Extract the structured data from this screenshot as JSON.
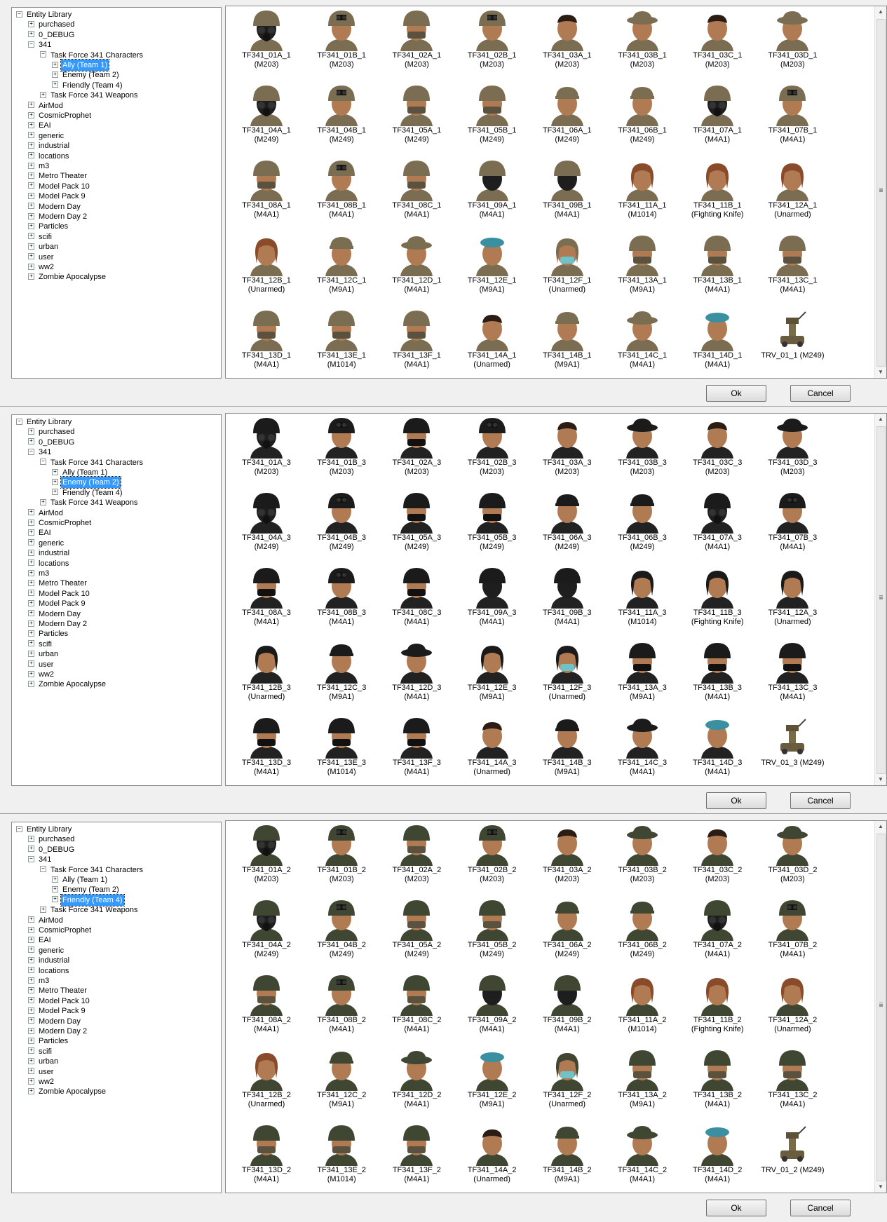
{
  "panels": [
    {
      "selected": "ally",
      "tree": [
        "Entity Library",
        "purchased",
        "0_DEBUG",
        "341",
        "Task Force 341 Characters",
        "Ally (Team 1)",
        "Enemy (Team 2)",
        "Friendly (Team 4)",
        "Task Force 341 Weapons",
        "AirMod",
        "CosmicProphet",
        "EAI",
        "generic",
        "industrial",
        "locations",
        "m3",
        "Metro Theater",
        "Model Pack 10",
        "Model Pack 9",
        "Modern Day",
        "Modern Day 2",
        "Particles",
        "scifi",
        "urban",
        "user",
        "ww2",
        "Zombie Apocalypse"
      ],
      "items": [
        [
          "TF341_01A_1",
          "(M203)",
          "gasmask"
        ],
        [
          "TF341_01B_1",
          "(M203)",
          "nvg"
        ],
        [
          "TF341_02A_1",
          "(M203)",
          "helmet"
        ],
        [
          "TF341_02B_1",
          "(M203)",
          "nvg"
        ],
        [
          "TF341_03A_1",
          "(M203)",
          "face"
        ],
        [
          "TF341_03B_1",
          "(M203)",
          "boonie"
        ],
        [
          "TF341_03C_1",
          "(M203)",
          "face"
        ],
        [
          "TF341_03D_1",
          "(M203)",
          "boonie"
        ],
        [
          "TF341_04A_1",
          "(M249)",
          "gasmask"
        ],
        [
          "TF341_04B_1",
          "(M249)",
          "nvg"
        ],
        [
          "TF341_05A_1",
          "(M249)",
          "helmet"
        ],
        [
          "TF341_05B_1",
          "(M249)",
          "helmet"
        ],
        [
          "TF341_06A_1",
          "(M249)",
          "cap"
        ],
        [
          "TF341_06B_1",
          "(M249)",
          "cap"
        ],
        [
          "TF341_07A_1",
          "(M4A1)",
          "gasmask"
        ],
        [
          "TF341_07B_1",
          "(M4A1)",
          "nvg"
        ],
        [
          "TF341_08A_1",
          "(M4A1)",
          "helmet"
        ],
        [
          "TF341_08B_1",
          "(M4A1)",
          "nvg"
        ],
        [
          "TF341_08C_1",
          "(M4A1)",
          "helmet"
        ],
        [
          "TF341_09A_1",
          "(M4A1)",
          "balaclava"
        ],
        [
          "TF341_09B_1",
          "(M4A1)",
          "balaclava"
        ],
        [
          "TF341_11A_1",
          "(M1014)",
          "woman"
        ],
        [
          "TF341_11B_1",
          "(Fighting Knife)",
          "woman"
        ],
        [
          "TF341_12A_1",
          "(Unarmed)",
          "woman"
        ],
        [
          "TF341_12B_1",
          "(Unarmed)",
          "woman"
        ],
        [
          "TF341_12C_1",
          "(M9A1)",
          "cap"
        ],
        [
          "TF341_12D_1",
          "(M4A1)",
          "boonie"
        ],
        [
          "TF341_12E_1",
          "(M9A1)",
          "beret"
        ],
        [
          "TF341_12F_1",
          "(Unarmed)",
          "mask"
        ],
        [
          "TF341_13A_1",
          "(M9A1)",
          "helmet"
        ],
        [
          "TF341_13B_1",
          "(M4A1)",
          "helmet"
        ],
        [
          "TF341_13C_1",
          "(M4A1)",
          "helmet"
        ],
        [
          "TF341_13D_1",
          "(M4A1)",
          "helmet"
        ],
        [
          "TF341_13E_1",
          "(M1014)",
          "helmet"
        ],
        [
          "TF341_13F_1",
          "(M4A1)",
          "helmet"
        ],
        [
          "TF341_14A_1",
          "(Unarmed)",
          "face"
        ],
        [
          "TF341_14B_1",
          "(M9A1)",
          "cap"
        ],
        [
          "TF341_14C_1",
          "(M4A1)",
          "boonie"
        ],
        [
          "TF341_14D_1",
          "(M4A1)",
          "beret"
        ],
        [
          "TRV_01_1 (M249)",
          "",
          "robot"
        ]
      ],
      "tone": "camo"
    },
    {
      "selected": "enemy",
      "tree": [
        "Entity Library",
        "purchased",
        "0_DEBUG",
        "341",
        "Task Force 341 Characters",
        "Ally (Team 1)",
        "Enemy (Team 2)",
        "Friendly (Team 4)",
        "Task Force 341 Weapons",
        "AirMod",
        "CosmicProphet",
        "EAI",
        "generic",
        "industrial",
        "locations",
        "m3",
        "Metro Theater",
        "Model Pack 10",
        "Model Pack 9",
        "Modern Day",
        "Modern Day 2",
        "Particles",
        "scifi",
        "urban",
        "user",
        "ww2",
        "Zombie Apocalypse"
      ],
      "items": [
        [
          "TF341_01A_3",
          "(M203)",
          "gasmask"
        ],
        [
          "TF341_01B_3",
          "(M203)",
          "nvg"
        ],
        [
          "TF341_02A_3",
          "(M203)",
          "helmet"
        ],
        [
          "TF341_02B_3",
          "(M203)",
          "nvg"
        ],
        [
          "TF341_03A_3",
          "(M203)",
          "face"
        ],
        [
          "TF341_03B_3",
          "(M203)",
          "boonie"
        ],
        [
          "TF341_03C_3",
          "(M203)",
          "face"
        ],
        [
          "TF341_03D_3",
          "(M203)",
          "boonie"
        ],
        [
          "TF341_04A_3",
          "(M249)",
          "gasmask"
        ],
        [
          "TF341_04B_3",
          "(M249)",
          "nvg"
        ],
        [
          "TF341_05A_3",
          "(M249)",
          "helmet"
        ],
        [
          "TF341_05B_3",
          "(M249)",
          "helmet"
        ],
        [
          "TF341_06A_3",
          "(M249)",
          "cap"
        ],
        [
          "TF341_06B_3",
          "(M249)",
          "cap"
        ],
        [
          "TF341_07A_3",
          "(M4A1)",
          "gasmask"
        ],
        [
          "TF341_07B_3",
          "(M4A1)",
          "nvg"
        ],
        [
          "TF341_08A_3",
          "(M4A1)",
          "helmet"
        ],
        [
          "TF341_08B_3",
          "(M4A1)",
          "nvg"
        ],
        [
          "TF341_08C_3",
          "(M4A1)",
          "helmet"
        ],
        [
          "TF341_09A_3",
          "(M4A1)",
          "balaclava"
        ],
        [
          "TF341_09B_3",
          "(M4A1)",
          "balaclava"
        ],
        [
          "TF341_11A_3",
          "(M1014)",
          "woman"
        ],
        [
          "TF341_11B_3",
          "(Fighting Knife)",
          "woman"
        ],
        [
          "TF341_12A_3",
          "(Unarmed)",
          "woman"
        ],
        [
          "TF341_12B_3",
          "(Unarmed)",
          "woman"
        ],
        [
          "TF341_12C_3",
          "(M9A1)",
          "cap"
        ],
        [
          "TF341_12D_3",
          "(M4A1)",
          "boonie"
        ],
        [
          "TF341_12E_3",
          "(M9A1)",
          "woman"
        ],
        [
          "TF341_12F_3",
          "(Unarmed)",
          "mask"
        ],
        [
          "TF341_13A_3",
          "(M9A1)",
          "helmet"
        ],
        [
          "TF341_13B_3",
          "(M4A1)",
          "helmet"
        ],
        [
          "TF341_13C_3",
          "(M4A1)",
          "helmet"
        ],
        [
          "TF341_13D_3",
          "(M4A1)",
          "helmet"
        ],
        [
          "TF341_13E_3",
          "(M1014)",
          "helmet"
        ],
        [
          "TF341_13F_3",
          "(M4A1)",
          "helmet"
        ],
        [
          "TF341_14A_3",
          "(Unarmed)",
          "face"
        ],
        [
          "TF341_14B_3",
          "(M9A1)",
          "cap"
        ],
        [
          "TF341_14C_3",
          "(M4A1)",
          "boonie"
        ],
        [
          "TF341_14D_3",
          "(M4A1)",
          "beret"
        ],
        [
          "TRV_01_3 (M249)",
          "",
          "robot"
        ]
      ],
      "tone": "black"
    },
    {
      "selected": "friendly",
      "tree": [
        "Entity Library",
        "purchased",
        "0_DEBUG",
        "341",
        "Task Force 341 Characters",
        "Ally (Team 1)",
        "Enemy (Team 2)",
        "Friendly (Team 4)",
        "Task Force 341 Weapons",
        "AirMod",
        "CosmicProphet",
        "EAI",
        "generic",
        "industrial",
        "locations",
        "m3",
        "Metro Theater",
        "Model Pack 10",
        "Model Pack 9",
        "Modern Day",
        "Modern Day 2",
        "Particles",
        "scifi",
        "urban",
        "user",
        "ww2",
        "Zombie Apocalypse"
      ],
      "items": [
        [
          "TF341_01A_2",
          "(M203)",
          "gasmask"
        ],
        [
          "TF341_01B_2",
          "(M203)",
          "nvg"
        ],
        [
          "TF341_02A_2",
          "(M203)",
          "helmet"
        ],
        [
          "TF341_02B_2",
          "(M203)",
          "nvg"
        ],
        [
          "TF341_03A_2",
          "(M203)",
          "face"
        ],
        [
          "TF341_03B_2",
          "(M203)",
          "boonie"
        ],
        [
          "TF341_03C_2",
          "(M203)",
          "face"
        ],
        [
          "TF341_03D_2",
          "(M203)",
          "boonie"
        ],
        [
          "TF341_04A_2",
          "(M249)",
          "gasmask"
        ],
        [
          "TF341_04B_2",
          "(M249)",
          "nvg"
        ],
        [
          "TF341_05A_2",
          "(M249)",
          "helmet"
        ],
        [
          "TF341_05B_2",
          "(M249)",
          "helmet"
        ],
        [
          "TF341_06A_2",
          "(M249)",
          "cap"
        ],
        [
          "TF341_06B_2",
          "(M249)",
          "cap"
        ],
        [
          "TF341_07A_2",
          "(M4A1)",
          "gasmask"
        ],
        [
          "TF341_07B_2",
          "(M4A1)",
          "nvg"
        ],
        [
          "TF341_08A_2",
          "(M4A1)",
          "helmet"
        ],
        [
          "TF341_08B_2",
          "(M4A1)",
          "nvg"
        ],
        [
          "TF341_08C_2",
          "(M4A1)",
          "helmet"
        ],
        [
          "TF341_09A_2",
          "(M4A1)",
          "balaclava"
        ],
        [
          "TF341_09B_2",
          "(M4A1)",
          "balaclava"
        ],
        [
          "TF341_11A_2",
          "(M1014)",
          "woman"
        ],
        [
          "TF341_11B_2",
          "(Fighting Knife)",
          "woman"
        ],
        [
          "TF341_12A_2",
          "(Unarmed)",
          "woman"
        ],
        [
          "TF341_12B_2",
          "(Unarmed)",
          "woman"
        ],
        [
          "TF341_12C_2",
          "(M9A1)",
          "cap"
        ],
        [
          "TF341_12D_2",
          "(M4A1)",
          "boonie"
        ],
        [
          "TF341_12E_2",
          "(M9A1)",
          "beret"
        ],
        [
          "TF341_12F_2",
          "(Unarmed)",
          "mask"
        ],
        [
          "TF341_13A_2",
          "(M9A1)",
          "helmet"
        ],
        [
          "TF341_13B_2",
          "(M4A1)",
          "helmet"
        ],
        [
          "TF341_13C_2",
          "(M4A1)",
          "helmet"
        ],
        [
          "TF341_13D_2",
          "(M4A1)",
          "helmet"
        ],
        [
          "TF341_13E_2",
          "(M1014)",
          "helmet"
        ],
        [
          "TF341_13F_2",
          "(M4A1)",
          "helmet"
        ],
        [
          "TF341_14A_2",
          "(Unarmed)",
          "face"
        ],
        [
          "TF341_14B_2",
          "(M9A1)",
          "cap"
        ],
        [
          "TF341_14C_2",
          "(M4A1)",
          "boonie"
        ],
        [
          "TF341_14D_2",
          "(M4A1)",
          "beret"
        ],
        [
          "TRV_01_2 (M249)",
          "",
          "robot"
        ]
      ],
      "tone": "green"
    }
  ],
  "buttons": {
    "ok": "Ok",
    "cancel": "Cancel"
  },
  "colors": {
    "selection": "#3399ff",
    "camo": "#7a6d52",
    "black": "#1b1b1b",
    "green": "#3f4632",
    "skin": "#b07a52",
    "beret": "#3a8fa0"
  }
}
